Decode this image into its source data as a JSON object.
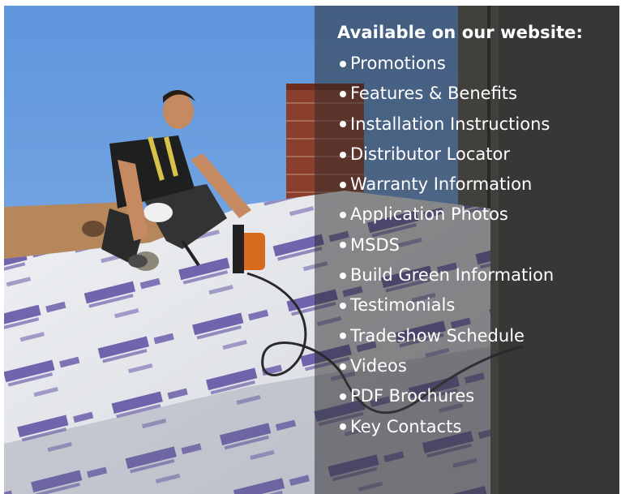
{
  "panel": {
    "title": "Available on our website:",
    "items": [
      "Promotions",
      "Features & Benefits",
      "Installation Instructions",
      "Distributor Locator",
      "Warranty Information",
      "Application Photos",
      "MSDS",
      "Build Green Information",
      "Testimonials",
      "Tradeshow Schedule",
      "Videos",
      "PDF Brochures",
      "Key Contacts"
    ]
  },
  "colors": {
    "sky": "#6b9fe0",
    "underlayment": "#e4e6ea",
    "print_purple": "#4c3c9a",
    "roof_deck": "#b5875a",
    "brick": "#8c3e2c",
    "house_wall": "#504c47",
    "overlay": "#282828"
  },
  "photo": {
    "subject": "roofer kneeling on roof installing synthetic underlayment with nail gun"
  }
}
